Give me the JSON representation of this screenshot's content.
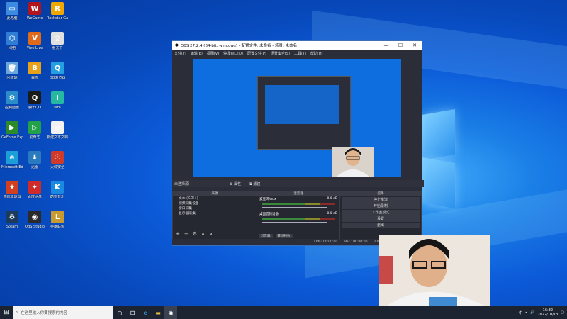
{
  "desktop": {
    "icons": [
      {
        "label": "此电脑",
        "color": "#3d8be0",
        "glyph": "▭"
      },
      {
        "label": "网络",
        "color": "#2f7dd4",
        "glyph": "⌬"
      },
      {
        "label": "回收站",
        "color": "#6aa7dc",
        "glyph": "🗑"
      },
      {
        "label": "控制面板",
        "color": "#2a8cc9",
        "glyph": "⚙"
      },
      {
        "label": "GeForce Experience",
        "color": "#2b8a2b",
        "glyph": "▶"
      },
      {
        "label": "Microsoft Edge",
        "color": "#1c9fd6",
        "glyph": "e"
      },
      {
        "label": "游戏加速器",
        "color": "#d04020",
        "glyph": "★"
      },
      {
        "label": "Steam",
        "color": "#1b3a5c",
        "glyph": "⚙"
      },
      {
        "label": "WeGame",
        "color": "#b0141c",
        "glyph": "W"
      },
      {
        "label": "Vivo Live",
        "color": "#e06a1a",
        "glyph": "V"
      },
      {
        "label": "暴雪",
        "color": "#e8a21a",
        "glyph": "B"
      },
      {
        "label": "腾讯QQ",
        "color": "#1a1a1a",
        "glyph": "Q"
      },
      {
        "label": "爱奇艺",
        "color": "#22a04a",
        "glyph": "▷"
      },
      {
        "label": "迅雷",
        "color": "#2a7ac0",
        "glyph": "⬇"
      },
      {
        "label": "百度网盘",
        "color": "#d02a2a",
        "glyph": "✦"
      },
      {
        "label": "OBS Studio",
        "color": "#2a2a2a",
        "glyph": "◉"
      },
      {
        "label": "Rockstar Games",
        "color": "#f0a800",
        "glyph": "R"
      },
      {
        "label": "看天下",
        "color": "#e0e0e0",
        "glyph": "◎"
      },
      {
        "label": "QQ浏览器",
        "color": "#24a0e0",
        "glyph": "Q"
      },
      {
        "label": "Iam",
        "color": "#26b8a0",
        "glyph": "I"
      },
      {
        "label": "新建文本文档",
        "color": "#f2f2f2",
        "glyph": "▤"
      },
      {
        "label": "火绒安全",
        "color": "#d03a2a",
        "glyph": "☉"
      },
      {
        "label": "酷狗音乐",
        "color": "#1a8ae0",
        "glyph": "K"
      },
      {
        "label": "英雄联盟",
        "color": "#c89a30",
        "glyph": "L"
      }
    ]
  },
  "obs": {
    "title": "OBS 27.2.4 (64-bit, windows) - 配置文件: 未命名 - 场景: 未命名",
    "menu": [
      "文件(F)",
      "编辑(E)",
      "视图(V)",
      "停靠窗口(D)",
      "配置文件(P)",
      "场景集合(S)",
      "工具(T)",
      "帮助(H)"
    ],
    "source_bar_label": "未选择源",
    "props_btn": "属性",
    "filters_btn": "滤镜",
    "sources_dock_title": "来源",
    "sources": [
      "文本 (GDI+)",
      "视频采集设备",
      "窗口采集",
      "显示器采集"
    ],
    "mixer_dock_title": "混音器",
    "mixer": [
      {
        "name": "麦克风/Aux",
        "db": "0.0 dB"
      },
      {
        "name": "桌面音频设备",
        "db": "0.0 dB"
      }
    ],
    "mixer_tabs": [
      "混音器",
      "转场特效"
    ],
    "controls_dock_title": "控件",
    "controls": [
      "停止推流",
      "开始录制",
      "工作室模式",
      "设置",
      "退出"
    ],
    "status": {
      "live": "LIVE: 00:00:00",
      "rec": "REC: 00:00:00",
      "cpu": "CPU: 0.5%, 60.00 fps",
      "hint": "设置"
    }
  },
  "taskbar": {
    "search_placeholder": "在这里输入你要搜索的内容",
    "time": "16:32",
    "date": "2022/10/13",
    "tray_lang": "中"
  }
}
